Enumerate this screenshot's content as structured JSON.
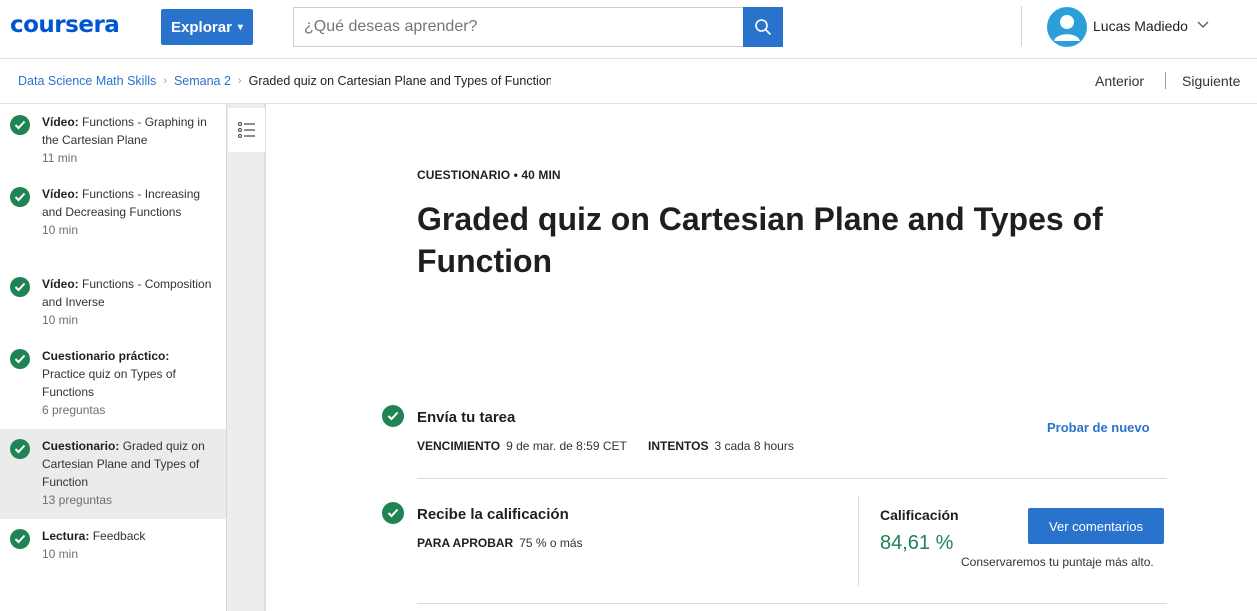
{
  "header": {
    "logo": "coursera",
    "explore_label": "Explorar",
    "search_placeholder": "¿Qué deseas aprender?",
    "user_name": "Lucas Madiedo"
  },
  "breadcrumb": {
    "course": "Data Science Math Skills",
    "week": "Semana 2",
    "current": "Graded quiz on Cartesian Plane and Types of Function"
  },
  "nav": {
    "prev": "Anterior",
    "next": "Siguiente"
  },
  "sidebar": {
    "items": [
      {
        "type": "Vídeo:",
        "title": "Functions - Graphing in the Cartesian Plane",
        "meta": "11 min",
        "completed": true,
        "active": false
      },
      {
        "type": "Vídeo:",
        "title": "Functions - Increasing and Decreasing Functions",
        "meta": "10 min",
        "completed": true,
        "active": false
      },
      {
        "type": "Vídeo:",
        "title": "Functions - Composition and Inverse",
        "meta": "10 min",
        "completed": true,
        "active": false
      },
      {
        "type": "Cuestionario práctico:",
        "title": "Practice quiz on Types of Functions",
        "meta": "6 preguntas",
        "completed": true,
        "active": false
      },
      {
        "type": "Cuestionario:",
        "title": "Graded quiz on Cartesian Plane and Types of Function",
        "meta": "13 preguntas",
        "completed": true,
        "active": true
      },
      {
        "type": "Lectura:",
        "title": "Feedback",
        "meta": "10 min",
        "completed": true,
        "active": false
      }
    ]
  },
  "main": {
    "kicker": "CUESTIONARIO • 40 MIN",
    "title": "Graded quiz on Cartesian Plane and Types of Function",
    "submit": {
      "title": "Envía tu tarea",
      "due_label": "VENCIMIENTO",
      "due_value": "9 de mar. de 8:59 CET",
      "attempts_label": "INTENTOS",
      "attempts_value": "3 cada 8 hours",
      "retry": "Probar de nuevo"
    },
    "grade": {
      "title": "Recibe la calificación",
      "pass_label": "PARA APROBAR",
      "pass_value": "75 % o más",
      "grade_label": "Calificación",
      "grade_value": "84,61 %",
      "feedback_button": "Ver comentarios",
      "keep_note": "Conservaremos tu puntaje más alto."
    }
  },
  "colors": {
    "accent": "#2a73cc",
    "success": "#1f8354",
    "logo": "#0056d2"
  }
}
